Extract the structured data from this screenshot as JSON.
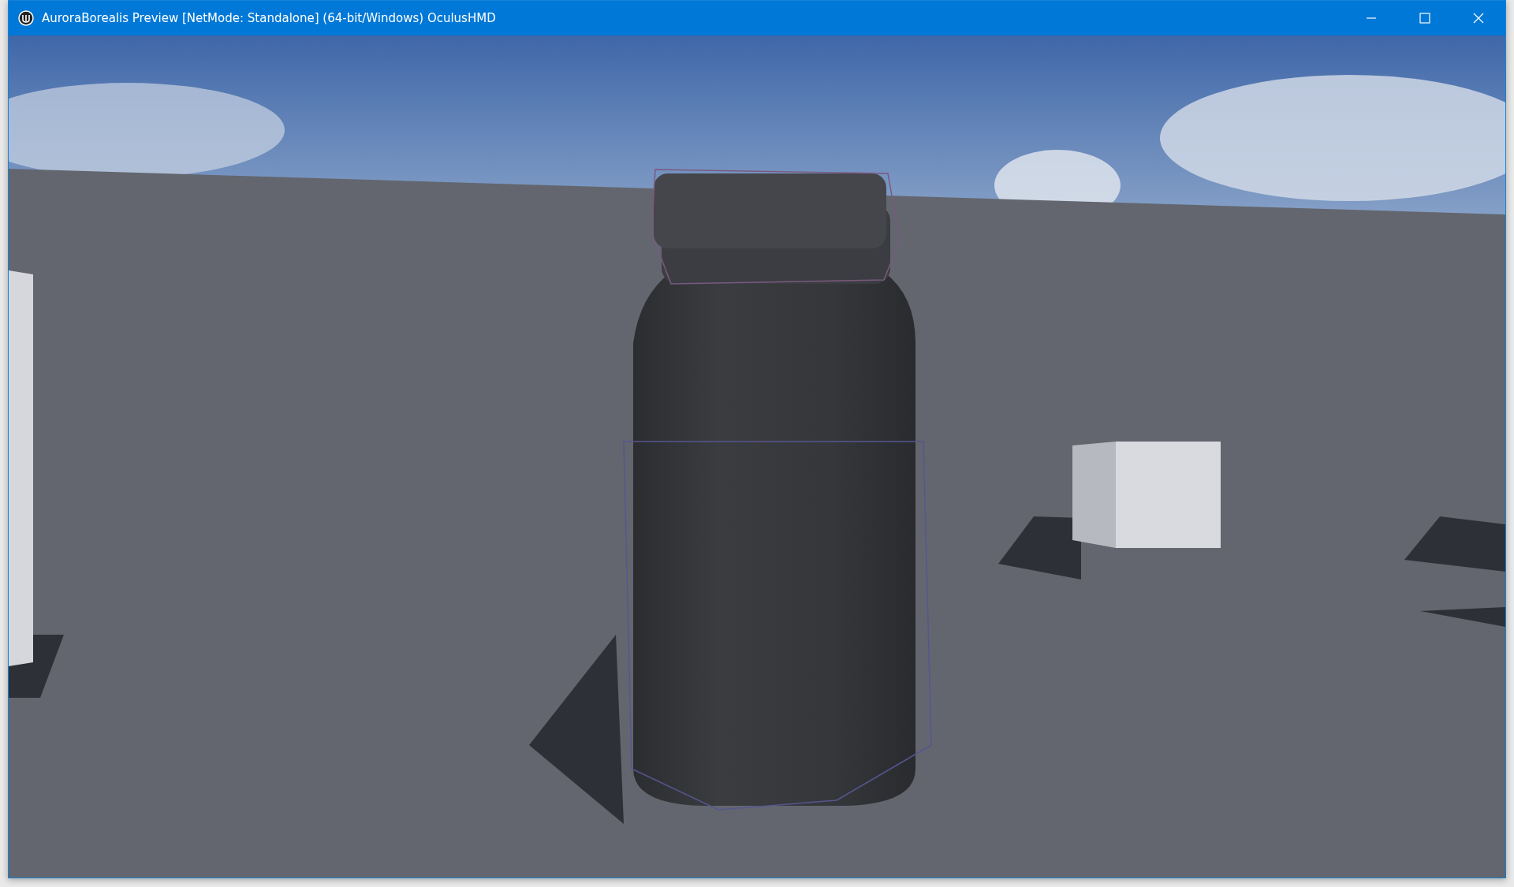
{
  "window": {
    "title": "AuroraBorealis Preview [NetMode: Standalone]  (64-bit/Windows) OculusHMD"
  }
}
